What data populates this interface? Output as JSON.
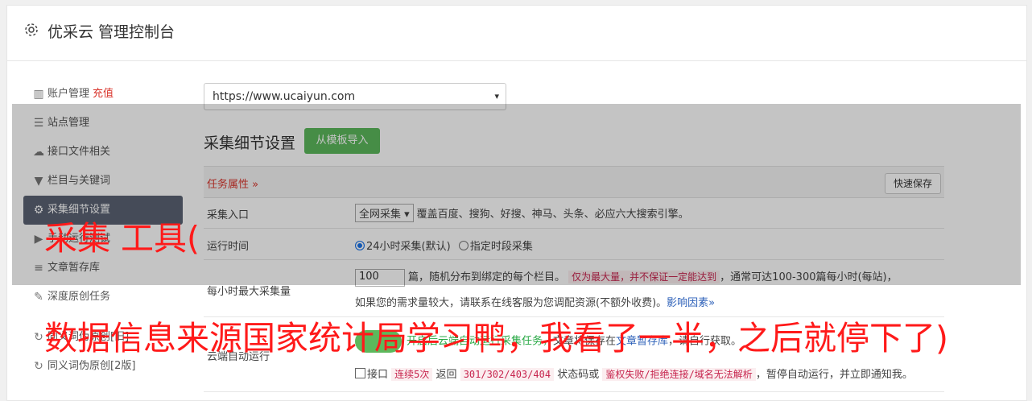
{
  "header": {
    "title": "优采云 管理控制台"
  },
  "sidebar": {
    "items": [
      {
        "icon": "bar-chart-icon",
        "glyph": "📊",
        "label": "账户管理",
        "extra": "充值"
      },
      {
        "icon": "server-icon",
        "glyph": "☰",
        "label": "站点管理"
      },
      {
        "icon": "cloud-upload-icon",
        "glyph": "☁",
        "label": "接口文件相关"
      },
      {
        "icon": "filter-icon",
        "glyph": "▼",
        "label": "栏目与关键词"
      },
      {
        "icon": "gears-icon",
        "glyph": "⚙",
        "label": "采集细节设置"
      },
      {
        "icon": "play-circle-icon",
        "glyph": "▶",
        "label": "手动运行测试"
      },
      {
        "icon": "database-icon",
        "glyph": "≡",
        "label": "文章暂存库"
      },
      {
        "icon": "edit-icon",
        "glyph": "✎",
        "label": "深度原创任务"
      },
      {
        "icon": "refresh-icon",
        "glyph": "↻",
        "label": "同义词伪原创[旧]"
      },
      {
        "icon": "refresh-icon",
        "glyph": "↻",
        "label": "同义词伪原创[2版]"
      }
    ]
  },
  "content": {
    "site_select": "https://www.ucaiyun.com",
    "section_title": "采集细节设置",
    "template_button": "从模板导入",
    "task_attr": "任务属性 »",
    "quick_save": "快速保存",
    "rows": {
      "entry": {
        "label": "采集入口",
        "select": "全网采集 ▾",
        "text": "覆盖百度、搜狗、好搜、神马、头条、必应六大搜索引擎。"
      },
      "runtime": {
        "label": "运行时间",
        "opt1": "24小时采集(默认)",
        "opt2": "指定时段采集"
      },
      "max": {
        "label": "每小时最大采集量",
        "value": "100",
        "line1_a": "篇，随机分布到绑定的每个栏目。",
        "line1_pink": "仅为最大量，并不保证一定能达到",
        "line1_b": "，通常可达100-300篇每小时(每站)，",
        "line2_a": "如果您的需求量较大，请联系在线客服为您调配资源(不额外收费)。",
        "line2_link": "影响因素»"
      },
      "cloud": {
        "label": "云端自动运行",
        "line1_green": "开启后云端自动运行采集任务，",
        "line1_a": "文章将保存在",
        "line1_link": "文章暂存库",
        "line1_b": "，请自行获取。",
        "line2_a": "接口",
        "line2_pink1": "连续5次",
        "line2_b": "返回",
        "line2_pink2": "301/302/403/404",
        "line2_c": "状态码或",
        "line2_pink3": "鉴权失败/拒绝连接/域名无法解析",
        "line2_d": "，暂停自动运行，并立即通知我。"
      }
    }
  },
  "overlay": {
    "line1": "采集 工具(",
    "line2": "数据信息来源国家统计局学习鸭，我看了一半，之后就停下了)"
  }
}
